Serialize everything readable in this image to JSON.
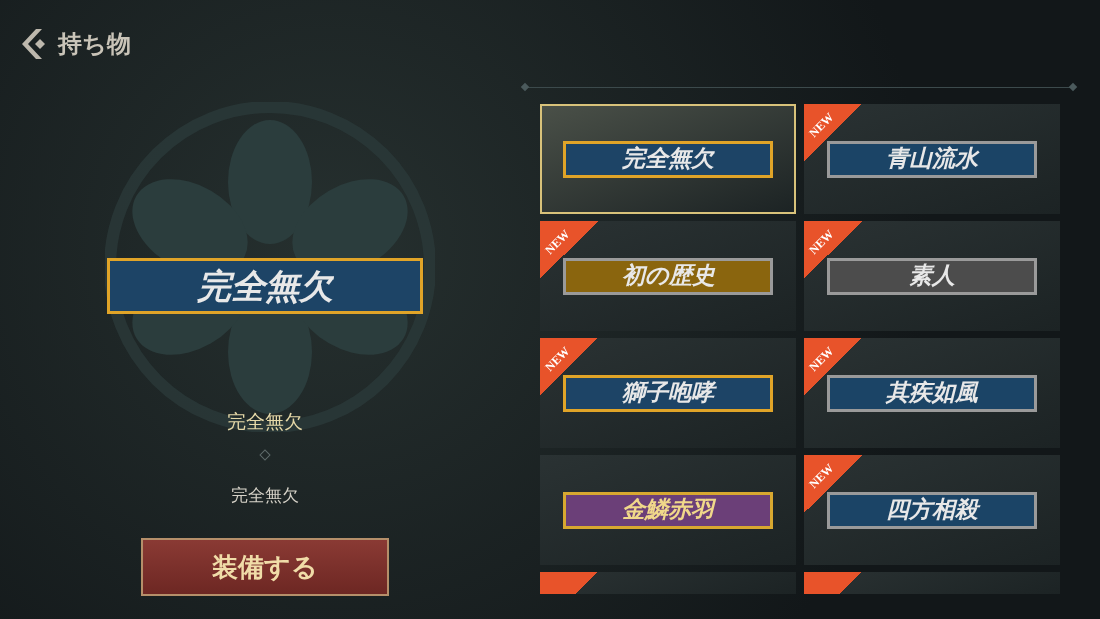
{
  "header": {
    "title": "持ち物"
  },
  "preview": {
    "banner": {
      "text": "完全無欠",
      "kind": "ornate_blue"
    },
    "name": "完全無欠",
    "description": "完全無欠",
    "equip_button": "装備する"
  },
  "cards": [
    {
      "text": "完全無欠",
      "kind": "ornate_blue",
      "selected": true,
      "ribbon": false
    },
    {
      "text": "青山流水",
      "kind": "blue",
      "selected": false,
      "ribbon": true,
      "badge": "NEW"
    },
    {
      "text": "初の歴史",
      "kind": "gold",
      "selected": false,
      "ribbon": true,
      "badge": "NEW"
    },
    {
      "text": "素人",
      "kind": "gray",
      "selected": false,
      "ribbon": true,
      "badge": "NEW"
    },
    {
      "text": "獅子咆哮",
      "kind": "ornate_blue",
      "selected": false,
      "ribbon": true,
      "badge": "NEW"
    },
    {
      "text": "其疾如風",
      "kind": "blue",
      "selected": false,
      "ribbon": true,
      "badge": "NEW"
    },
    {
      "text": "金鱗赤羽",
      "kind": "ornate_purple",
      "selected": false,
      "ribbon": false
    },
    {
      "text": "四方相殺",
      "kind": "blue",
      "selected": false,
      "ribbon": true,
      "badge": "NEW"
    },
    {
      "selected": false,
      "ribbon": true
    },
    {
      "selected": false,
      "ribbon": true
    }
  ]
}
